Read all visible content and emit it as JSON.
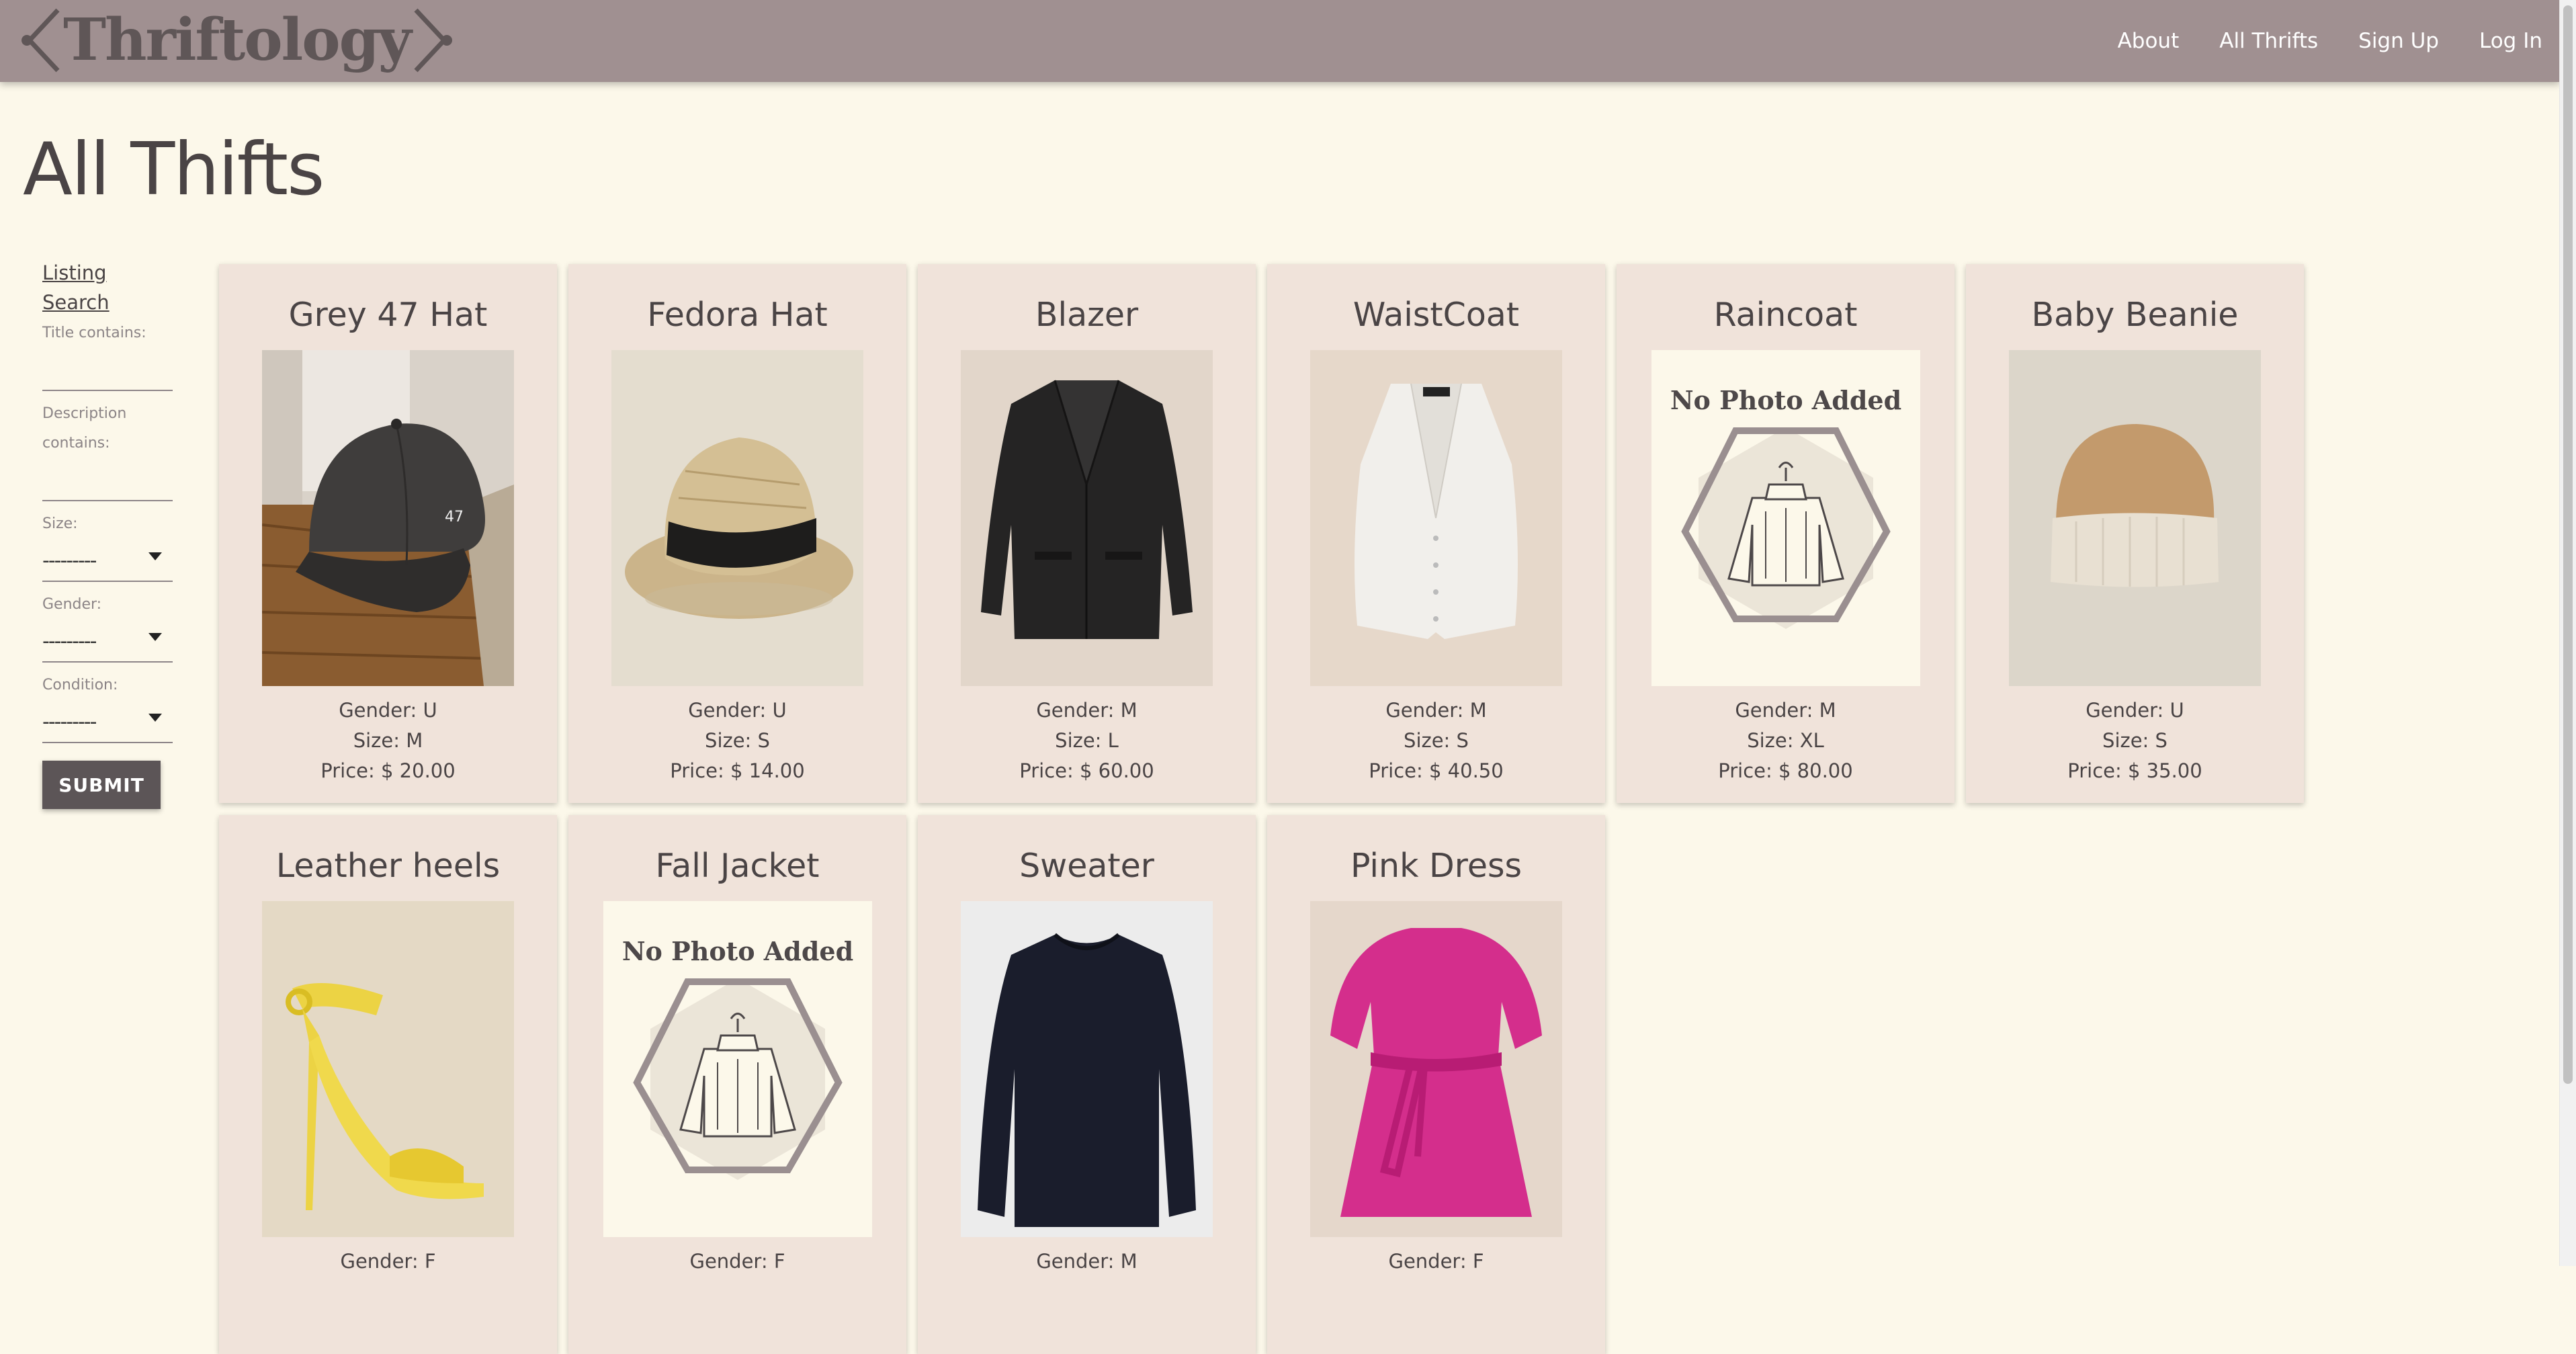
{
  "brand": "Thriftology",
  "nav": {
    "about": "About",
    "all_thrifts": "All Thrifts",
    "sign_up": "Sign Up",
    "log_in": "Log In"
  },
  "page_title": "All Thifts",
  "sidebar": {
    "title_line1": "Listing",
    "title_line2": "Search",
    "title_label": "Title contains:",
    "desc_label_line1": "Description",
    "desc_label_line2": "contains:",
    "size_label": "Size:",
    "size_value": "---------",
    "gender_label": "Gender:",
    "gender_value": "---------",
    "condition_label": "Condition:",
    "condition_value": "---------",
    "submit": "SUBMIT"
  },
  "no_photo_text": "No Photo Added",
  "colors": {
    "navbar": "#a09091",
    "background": "#fcf8ea",
    "card": "#f0e3da",
    "button": "#5c5557"
  },
  "listings": [
    {
      "title": "Grey 47 Hat",
      "gender": "Gender: U",
      "size": "Size: M",
      "price": "Price: $ 20.00",
      "image": "cap-photo"
    },
    {
      "title": "Fedora Hat",
      "gender": "Gender: U",
      "size": "Size: S",
      "price": "Price: $ 14.00",
      "image": "fedora-photo"
    },
    {
      "title": "Blazer",
      "gender": "Gender: M",
      "size": "Size: L",
      "price": "Price: $ 60.00",
      "image": "blazer-photo"
    },
    {
      "title": "WaistCoat",
      "gender": "Gender: M",
      "size": "Size: S",
      "price": "Price: $ 40.50",
      "image": "waistcoat-photo"
    },
    {
      "title": "Raincoat",
      "gender": "Gender: M",
      "size": "Size: XL",
      "price": "Price: $ 80.00",
      "image": "no-photo-placeholder"
    },
    {
      "title": "Baby Beanie",
      "gender": "Gender: U",
      "size": "Size: S",
      "price": "Price: $ 35.00",
      "image": "beanie-photo"
    },
    {
      "title": "Leather heels",
      "gender": "Gender: F",
      "size": "",
      "price": "",
      "image": "heels-photo"
    },
    {
      "title": "Fall Jacket",
      "gender": "Gender: F",
      "size": "",
      "price": "",
      "image": "no-photo-placeholder"
    },
    {
      "title": "Sweater",
      "gender": "Gender: M",
      "size": "",
      "price": "",
      "image": "sweater-photo"
    },
    {
      "title": "Pink Dress",
      "gender": "Gender: F",
      "size": "",
      "price": "",
      "image": "dress-photo"
    }
  ]
}
